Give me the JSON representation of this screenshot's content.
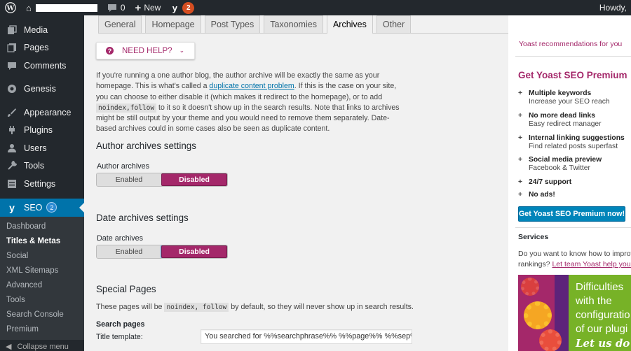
{
  "adminbar": {
    "comments_count": "0",
    "new_label": "New",
    "yoast_badge": "2",
    "howdy": "Howdy,"
  },
  "sidebar": {
    "items": [
      {
        "label": "Media",
        "icon": "media-icon"
      },
      {
        "label": "Pages",
        "icon": "pages-icon"
      },
      {
        "label": "Comments",
        "icon": "comments-icon"
      },
      {
        "label": "Genesis",
        "icon": "genesis-icon"
      },
      {
        "label": "Appearance",
        "icon": "appearance-icon"
      },
      {
        "label": "Plugins",
        "icon": "plugins-icon"
      },
      {
        "label": "Users",
        "icon": "users-icon"
      },
      {
        "label": "Tools",
        "icon": "tools-icon"
      },
      {
        "label": "Settings",
        "icon": "settings-icon"
      }
    ],
    "seo": {
      "label": "SEO",
      "badge": "2"
    },
    "submenu": [
      "Dashboard",
      "Titles & Metas",
      "Social",
      "XML Sitemaps",
      "Advanced",
      "Tools",
      "Search Console",
      "Premium"
    ],
    "current_sub": "Titles & Metas",
    "collapse_label": "Collapse menu"
  },
  "tabs": [
    "General",
    "Homepage",
    "Post Types",
    "Taxonomies",
    "Archives",
    "Other"
  ],
  "active_tab": "Archives",
  "help_button": "NEED HELP?",
  "intro": {
    "part1": "If you're running a one author blog, the author archive will be exactly the same as your homepage. This is what's called a ",
    "link": "duplicate content problem",
    "part2": ". If this is the case on your site, you can choose to either disable it (which makes it redirect to the homepage), or to add ",
    "code": "noindex,follow",
    "part3": " to it so it doesn't show up in the search results. Note that links to archives might be still output by your theme and you would need to remove them separately. Date-based archives could in some cases also be seen as duplicate content."
  },
  "author_section": {
    "heading": "Author archives settings",
    "label": "Author archives",
    "enabled": "Enabled",
    "disabled": "Disabled"
  },
  "date_section": {
    "heading": "Date archives settings",
    "label": "Date archives",
    "enabled": "Enabled",
    "disabled": "Disabled"
  },
  "special": {
    "heading": "Special Pages",
    "text1": "These pages will be ",
    "code": "noindex, follow",
    "text2": " by default, so they will never show up in search results.",
    "search_pages": "Search pages",
    "title_label": "Title template:",
    "title_value": "You searched for %%searchphrase%% %%page%% %%sep%"
  },
  "yoast_sidebar": {
    "recommendations": "Yoast recommendations for you",
    "premium_title": "Get Yoast SEO Premium",
    "features": [
      {
        "title": "Multiple keywords",
        "sub": "Increase your SEO reach"
      },
      {
        "title": "No more dead links",
        "sub": "Easy redirect manager"
      },
      {
        "title": "Internal linking suggestions",
        "sub": "Find related posts superfast"
      },
      {
        "title": "Social media preview",
        "sub": "Facebook & Twitter"
      },
      {
        "title": "24/7 support",
        "sub": ""
      },
      {
        "title": "No ads!",
        "sub": ""
      }
    ],
    "premium_button": "Get Yoast SEO Premium now!",
    "services_heading": "Services",
    "services_text1": "Do you want to know how to improv",
    "services_text2": "rankings? ",
    "services_link": "Let team Yoast help you!",
    "banner_lines": [
      "Difficulties",
      "with the",
      "configuratio",
      "of our plugi"
    ],
    "banner_em": "Let us do i"
  },
  "colors": {
    "yoast_purple": "#a4286a",
    "wp_blue": "#0073aa",
    "admin_dark": "#23282d",
    "premium_button": "#0085ba"
  }
}
